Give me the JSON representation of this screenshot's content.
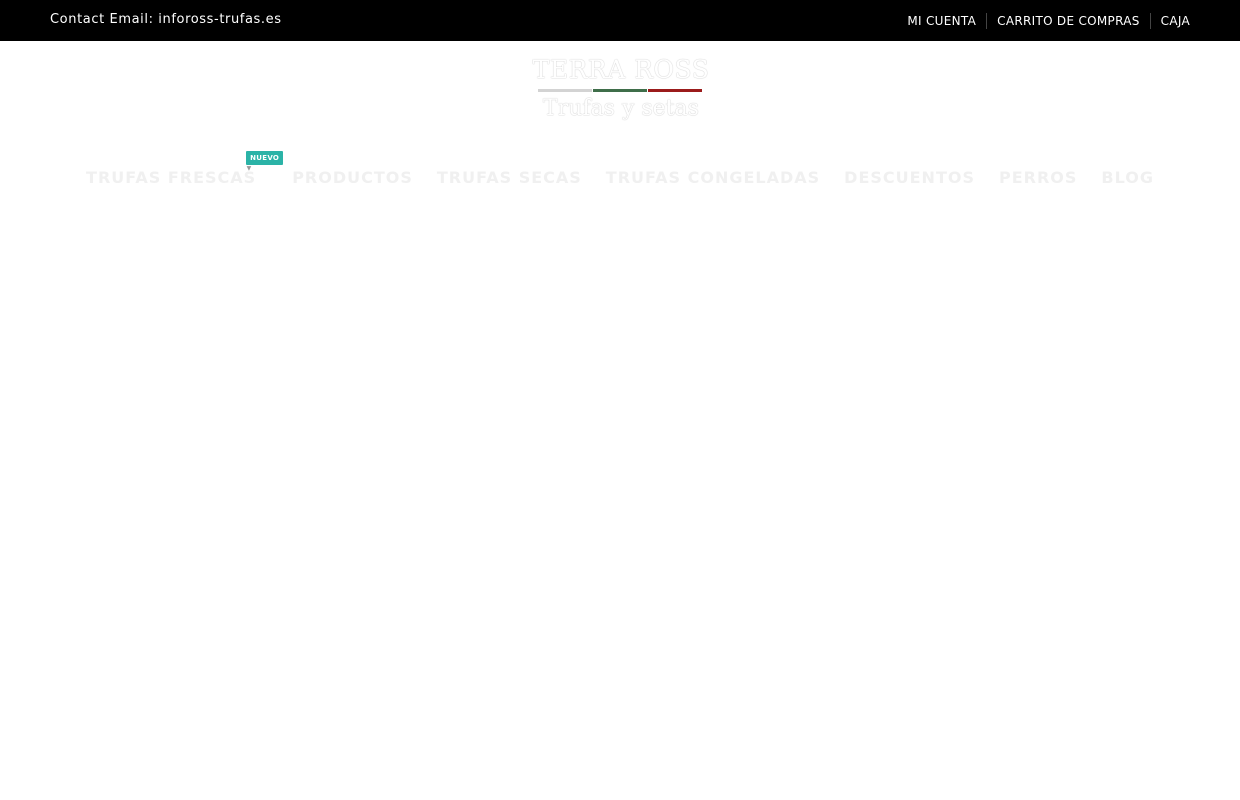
{
  "topbar": {
    "contact_text": "Contact Email: infoross-trufas.es",
    "links": [
      {
        "label": "MI CUENTA"
      },
      {
        "label": "CARRITO DE COMPRAS"
      },
      {
        "label": "CAJA"
      }
    ]
  },
  "logo": {
    "brand": "TERRA ROSS",
    "tagline": "Trufas y setas",
    "flag_colors": [
      "#d3d3d3",
      "#3f6e4a",
      "#9b1b1b"
    ]
  },
  "nav": {
    "items": [
      {
        "label": "TRUFAS FRESCAS",
        "badge": "NUEVO"
      },
      {
        "label": "PRODUCTOS"
      },
      {
        "label": "TRUFAS SECAS"
      },
      {
        "label": "TRUFAS CONGELADAS"
      },
      {
        "label": "DESCUENTOS"
      },
      {
        "label": "PERROS"
      },
      {
        "label": "BLOG"
      }
    ]
  },
  "colors": {
    "topbar_bg": "#000000",
    "badge_bg": "#2bb3a7",
    "nav_text": "#f0f0f0"
  }
}
